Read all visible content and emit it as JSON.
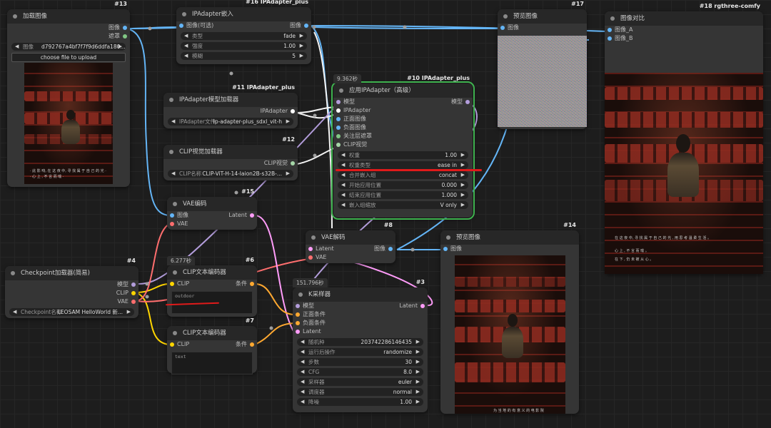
{
  "nodes": {
    "load_image": {
      "title": "加载图像",
      "id": "#13",
      "outputs": [
        "图像",
        "遮罩"
      ],
      "image_widget": {
        "label": "图像",
        "value": "d792767a4bf7f7f9d6ddfa180..."
      },
      "upload_label": "choose file to upload",
      "caption1": "· 此 影 响, 在 这 夜 中, 寻 找 属 于 自 己 的 光 ·",
      "caption2": "· 心 上 , 不 言 而 喻 ·"
    },
    "ipa_tiled": {
      "title": "IPAdapter嵌入",
      "id": "#16 IPAdapter_plus",
      "input": "图像(可选)",
      "output": "图像",
      "widgets": [
        {
          "label": "类型",
          "value": "fade"
        },
        {
          "label": "强度",
          "value": "1.00"
        },
        {
          "label": "模糊",
          "value": "5"
        }
      ]
    },
    "ipa_model_loader": {
      "title": "IPAdapter模型加载器",
      "id": "#11 IPAdapter_plus",
      "output": "IPAdapter",
      "widget": {
        "label": "IPAdapter文件",
        "value": "ip-adapter-plus_sdxl_vit-h"
      }
    },
    "clip_vision_loader": {
      "title": "CLIP视觉加载器",
      "id": "#12",
      "output": "CLIP视觉",
      "widget": {
        "label": "CLIP名称",
        "value": "CLIP-ViT-H-14-laion2B-s32B-..."
      }
    },
    "apply_ipa": {
      "title": "应用IPAdapter（高级）",
      "id": "#10 IPAdapter_plus",
      "timer": "9.362秒",
      "inputs": [
        "模型",
        "IPAdapter",
        "正面图像",
        "负面图像",
        "关注层遮罩",
        "CLIP视觉"
      ],
      "output": "模型",
      "widgets": [
        {
          "label": "权重",
          "value": "1.00"
        },
        {
          "label": "权重类型",
          "value": "ease in"
        },
        {
          "label": "合并嵌入组",
          "value": "concat"
        },
        {
          "label": "开始应用位置",
          "value": "0.000"
        },
        {
          "label": "结束应用位置",
          "value": "1.000"
        },
        {
          "label": "嵌入组缩放",
          "value": "V only"
        }
      ]
    },
    "preview17": {
      "title": "预览图像",
      "id": "#17",
      "input": "图像"
    },
    "compare": {
      "title": "图像对比",
      "id": "#18 rgthree-comfy",
      "inputs": [
        "图像_A",
        "图像_B"
      ],
      "caption1": "在 这 夜 中, 寻 找 属 于 自 己 的 光 , 用 思 考 温 柔 生 活 。",
      "caption2": "心 上 , 不 言 而 喻 。",
      "caption3": "在 下 , 仍 未 被 从 心 。"
    },
    "vae_encode": {
      "title": "VAE编码",
      "id": "#15",
      "inputs": [
        "图像",
        "VAE"
      ],
      "output": "Latent"
    },
    "checkpoint": {
      "title": "Checkpoint加载器(简易)",
      "id": "#4",
      "outputs": [
        "模型",
        "CLIP",
        "VAE"
      ],
      "widget": {
        "label": "Checkpoint名称",
        "value": "LEOSAM HelloWorld 新..."
      }
    },
    "clip_pos": {
      "title": "CLIP文本编码器",
      "id": "#6",
      "timer": "6.277秒",
      "input": "CLIP",
      "output": "条件",
      "text": "outdoor"
    },
    "clip_neg": {
      "title": "CLIP文本编码器",
      "id": "#7",
      "input": "CLIP",
      "output": "条件",
      "text": "text"
    },
    "vae_decode": {
      "title": "VAE解码",
      "id": "#8",
      "inputs": [
        "Latent",
        "VAE"
      ],
      "output": "图像"
    },
    "ksampler": {
      "title": "K采样器",
      "id": "#3",
      "timer": "151.796秒",
      "inputs": [
        "模型",
        "正面条件",
        "负面条件",
        "Latent"
      ],
      "output": "Latent",
      "widgets": [
        {
          "label": "随机种",
          "value": "203742286146435"
        },
        {
          "label": "运行后操作",
          "value": "randomize"
        },
        {
          "label": "步数",
          "value": "30"
        },
        {
          "label": "CFG",
          "value": "8.0"
        },
        {
          "label": "采样器",
          "value": "euler"
        },
        {
          "label": "调度器",
          "value": "normal"
        },
        {
          "label": "降噪",
          "value": "1.00"
        }
      ]
    },
    "preview14": {
      "title": "预览图像",
      "id": "#14",
      "input": "图像",
      "caption": "为 当 地 的 有 意 义 的 电 影 院"
    }
  },
  "colors": {
    "image": "#64b5f6",
    "mask": "#81c784",
    "model": "#b39ddb",
    "clip": "#ffd500",
    "vae": "#ff6e6e",
    "latent": "#ff9cf9",
    "conditioning": "#ffa931",
    "ipadapter": "#ffffff",
    "active_border": "#3fb24f",
    "annotation": "#e01a1a"
  }
}
